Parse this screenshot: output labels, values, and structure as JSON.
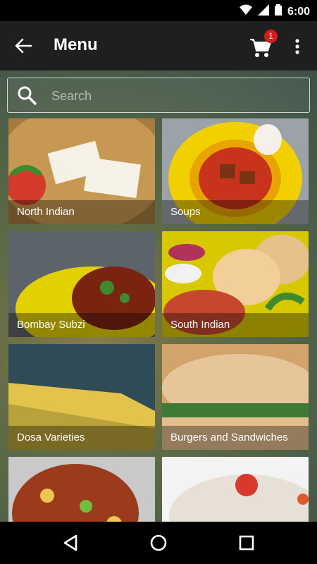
{
  "status": {
    "time": "6:00"
  },
  "appbar": {
    "title": "Menu",
    "cart_count": "1"
  },
  "search": {
    "placeholder": "Search"
  },
  "categories": [
    {
      "label": "North Indian"
    },
    {
      "label": "Soups"
    },
    {
      "label": "Bombay Subzi"
    },
    {
      "label": "South Indian"
    },
    {
      "label": "Dosa Varieties"
    },
    {
      "label": "Burgers and Sandwiches"
    },
    {
      "label": ""
    },
    {
      "label": ""
    }
  ]
}
